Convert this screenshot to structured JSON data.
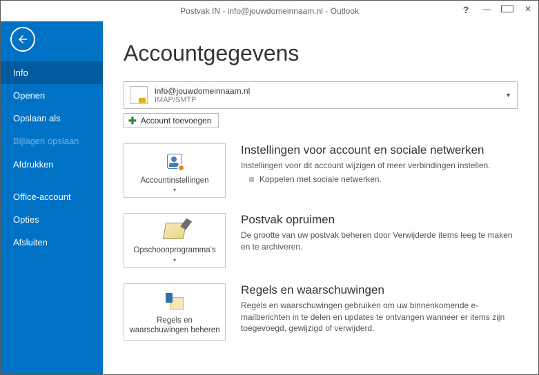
{
  "window": {
    "title": "Postvak IN - info@jouwdomeinnaam.nl - Outlook"
  },
  "sidebar": {
    "items": [
      {
        "label": "Info",
        "selected": true,
        "disabled": false
      },
      {
        "label": "Openen",
        "selected": false,
        "disabled": false
      },
      {
        "label": "Opslaan als",
        "selected": false,
        "disabled": false
      },
      {
        "label": "Bijlagen opslaan",
        "selected": false,
        "disabled": true
      },
      {
        "label": "Afdrukken",
        "selected": false,
        "disabled": false
      },
      {
        "label": "Office-account",
        "selected": false,
        "disabled": false
      },
      {
        "label": "Opties",
        "selected": false,
        "disabled": false
      },
      {
        "label": "Afsluiten",
        "selected": false,
        "disabled": false
      }
    ]
  },
  "page": {
    "heading": "Accountgegevens"
  },
  "account": {
    "email": "info@jouwdomeinnaam.nl",
    "protocol": "IMAP/SMTP",
    "add_label": "Account toevoegen"
  },
  "sections": {
    "settings": {
      "tile_label": "Accountinstellingen",
      "title": "Instellingen voor account en sociale netwerken",
      "desc": "Instellingen voor dit account wijzigen of meer verbindingen instellen.",
      "bullet": "Koppelen met sociale netwerken."
    },
    "cleanup": {
      "tile_label": "Opschoonprogramma's",
      "title": "Postvak opruimen",
      "desc": "De grootte van uw postvak beheren door Verwijderde items leeg te maken en te archiveren."
    },
    "rules": {
      "tile_label": "Regels en waarschuwingen beheren",
      "title": "Regels en waarschuwingen",
      "desc": "Regels en waarschuwingen gebruiken om uw binnenkomende e-mailberichten in te delen en updates te ontvangen wanneer er items zijn toegevoegd, gewijzigd of verwijderd."
    }
  }
}
